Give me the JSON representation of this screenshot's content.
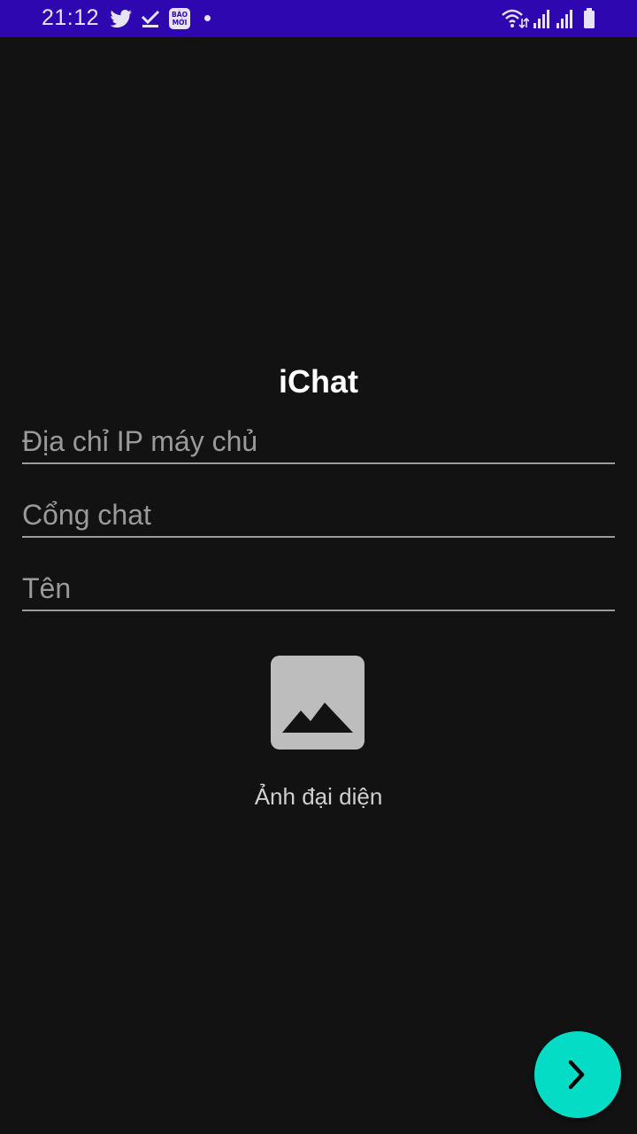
{
  "status_bar": {
    "time": "21:12",
    "background": "#2f07b0",
    "notification_icons": [
      "twitter-icon",
      "download-done-icon",
      "bao-moi-icon",
      "dot-icon"
    ],
    "bao_moi_badge": "BÁO MỚI",
    "system_icons": [
      "wifi-icon",
      "signal-icon",
      "signal-icon",
      "battery-icon"
    ]
  },
  "app": {
    "title": "iChat"
  },
  "form": {
    "ip_placeholder": "Địa chỉ IP máy chủ",
    "port_placeholder": "Cổng chat",
    "name_placeholder": "Tên",
    "ip_value": "",
    "port_value": "",
    "name_value": ""
  },
  "avatar": {
    "icon": "image-placeholder-icon",
    "label": "Ảnh đại diện"
  },
  "fab": {
    "icon": "chevron-right-icon",
    "color": "#04dcc6"
  },
  "colors": {
    "background": "#121212",
    "accent": "#04dcc6"
  }
}
